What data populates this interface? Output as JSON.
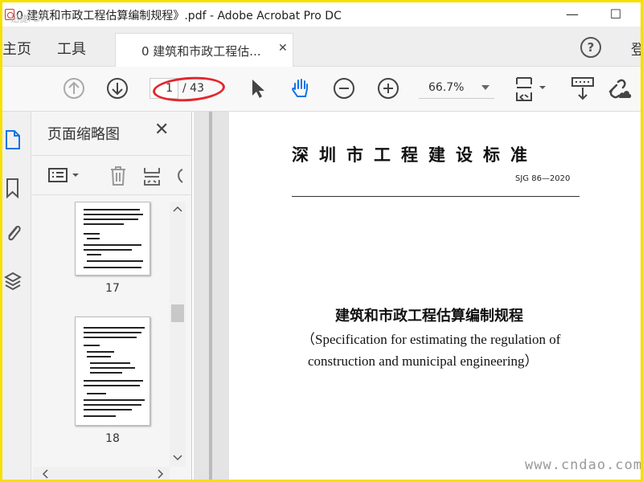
{
  "window": {
    "title": "0 建筑和市政工程估算编制规程》.pdf - Adobe Acrobat Pro DC",
    "corner_watermark": "迅捷PDF"
  },
  "tabs": {
    "home": "主页",
    "tools": "工具",
    "document": "0 建筑和市政工程估...",
    "signin": "登"
  },
  "toolbar": {
    "current_page": "1",
    "total_pages": "/ 43",
    "zoom": "66.7%"
  },
  "panel": {
    "title": "页面缩略图",
    "thumbnails": [
      {
        "page": "17"
      },
      {
        "page": "18"
      }
    ]
  },
  "document": {
    "standard_title": "深圳市工程建设标准",
    "standard_code": "SJG 86—2020",
    "heading": "建筑和市政工程估算编制规程",
    "english_line1": "（Specification for estimating the regulation of",
    "english_line2": "construction and municipal engineering）"
  },
  "watermark": "www.cndao.com",
  "colors": {
    "frame_border": "#f5e000",
    "annotation": "#e3262d",
    "active_icon": "#1473e6"
  }
}
